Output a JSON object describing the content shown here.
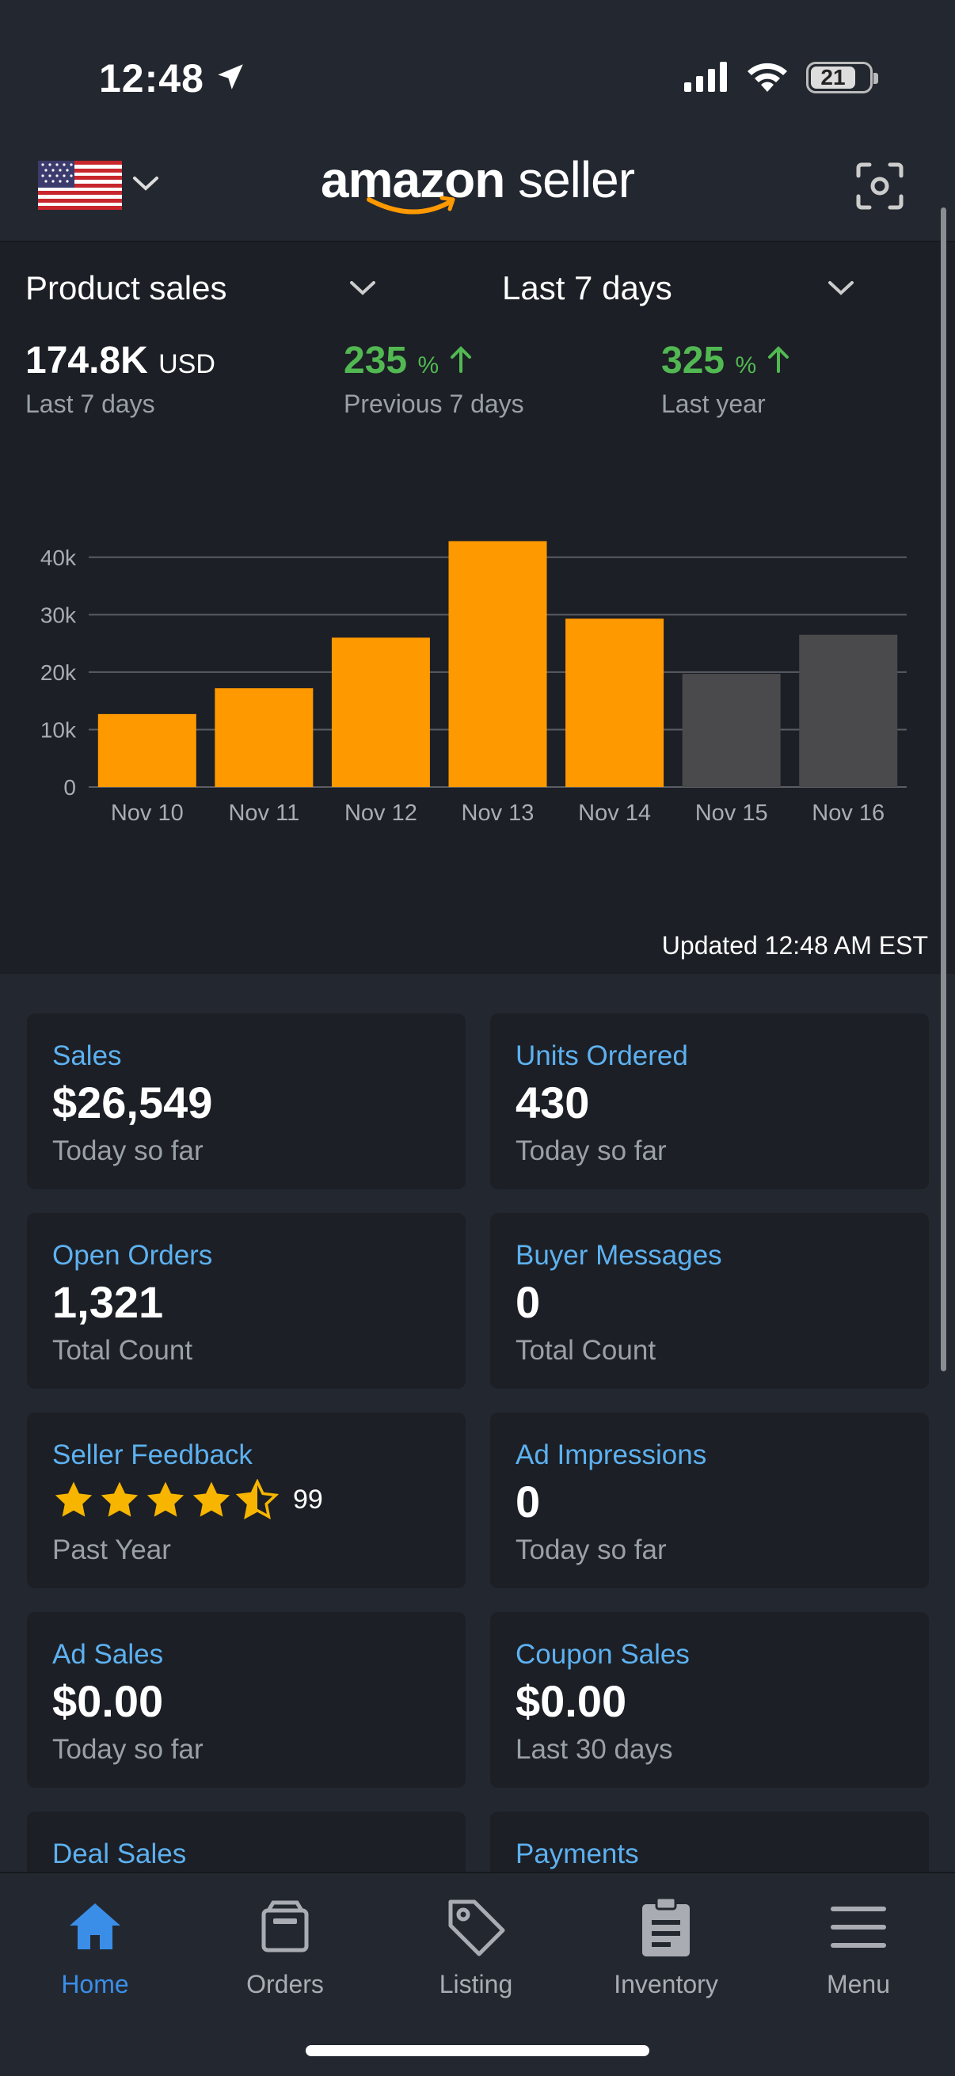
{
  "status": {
    "time": "12:48",
    "battery": "21"
  },
  "header": {
    "logo_main": "amazon",
    "logo_sub": "seller",
    "flag_icon": "us-flag-icon",
    "scan_icon": "scan-icon"
  },
  "summary": {
    "metric_dropdown": "Product sales",
    "period_dropdown": "Last 7 days",
    "total": {
      "value": "174.8K",
      "unit": "USD",
      "label": "Last 7 days"
    },
    "prev": {
      "value": "235",
      "unit": "%",
      "label": "Previous 7 days"
    },
    "year": {
      "value": "325",
      "unit": "%",
      "label": "Last year"
    },
    "updated": "Updated 12:48 AM EST"
  },
  "chart_data": {
    "type": "bar",
    "categories": [
      "Nov 10",
      "Nov 11",
      "Nov 12",
      "Nov 13",
      "Nov 14",
      "Nov 15",
      "Nov 16"
    ],
    "values": [
      12700,
      17200,
      26000,
      42800,
      29300,
      19700,
      26500
    ],
    "highlighted": [
      true,
      true,
      true,
      true,
      true,
      false,
      false
    ],
    "yticks": [
      "0",
      "10k",
      "20k",
      "30k",
      "40k"
    ],
    "ytick_values": [
      0,
      10000,
      20000,
      30000,
      40000
    ],
    "ylim": [
      0,
      43000
    ],
    "colors": {
      "current": "#ff9900",
      "previous": "#4a4a4c",
      "grid": "#5a5d63"
    },
    "grid": true
  },
  "cards": [
    {
      "title": "Sales",
      "value": "$26,549",
      "sub": "Today so far"
    },
    {
      "title": "Units Ordered",
      "value": "430",
      "sub": "Today so far"
    },
    {
      "title": "Open Orders",
      "value": "1,321",
      "sub": "Total Count"
    },
    {
      "title": "Buyer Messages",
      "value": "0",
      "sub": "Total Count"
    },
    {
      "title": "Seller Feedback",
      "rating": 4.5,
      "count": "99",
      "sub": "Past Year"
    },
    {
      "title": "Ad Impressions",
      "value": "0",
      "sub": "Today so far"
    },
    {
      "title": "Ad Sales",
      "value": "$0.00",
      "sub": "Today so far"
    },
    {
      "title": "Coupon Sales",
      "value": "$0.00",
      "sub": "Last 30 days"
    },
    {
      "title": "Deal Sales",
      "value": "",
      "sub": ""
    },
    {
      "title": "Payments",
      "value": "",
      "sub": ""
    }
  ],
  "tabs": [
    {
      "label": "Home",
      "icon": "home-icon",
      "active": true
    },
    {
      "label": "Orders",
      "icon": "box-icon",
      "active": false
    },
    {
      "label": "Listing",
      "icon": "tag-icon",
      "active": false
    },
    {
      "label": "Inventory",
      "icon": "clipboard-icon",
      "active": false
    },
    {
      "label": "Menu",
      "icon": "hamburger-icon",
      "active": false
    }
  ],
  "colors": {
    "accent_blue": "#5db1f0",
    "tab_active": "#3a8ee8",
    "green": "#52b852",
    "star": "#f7b500"
  }
}
